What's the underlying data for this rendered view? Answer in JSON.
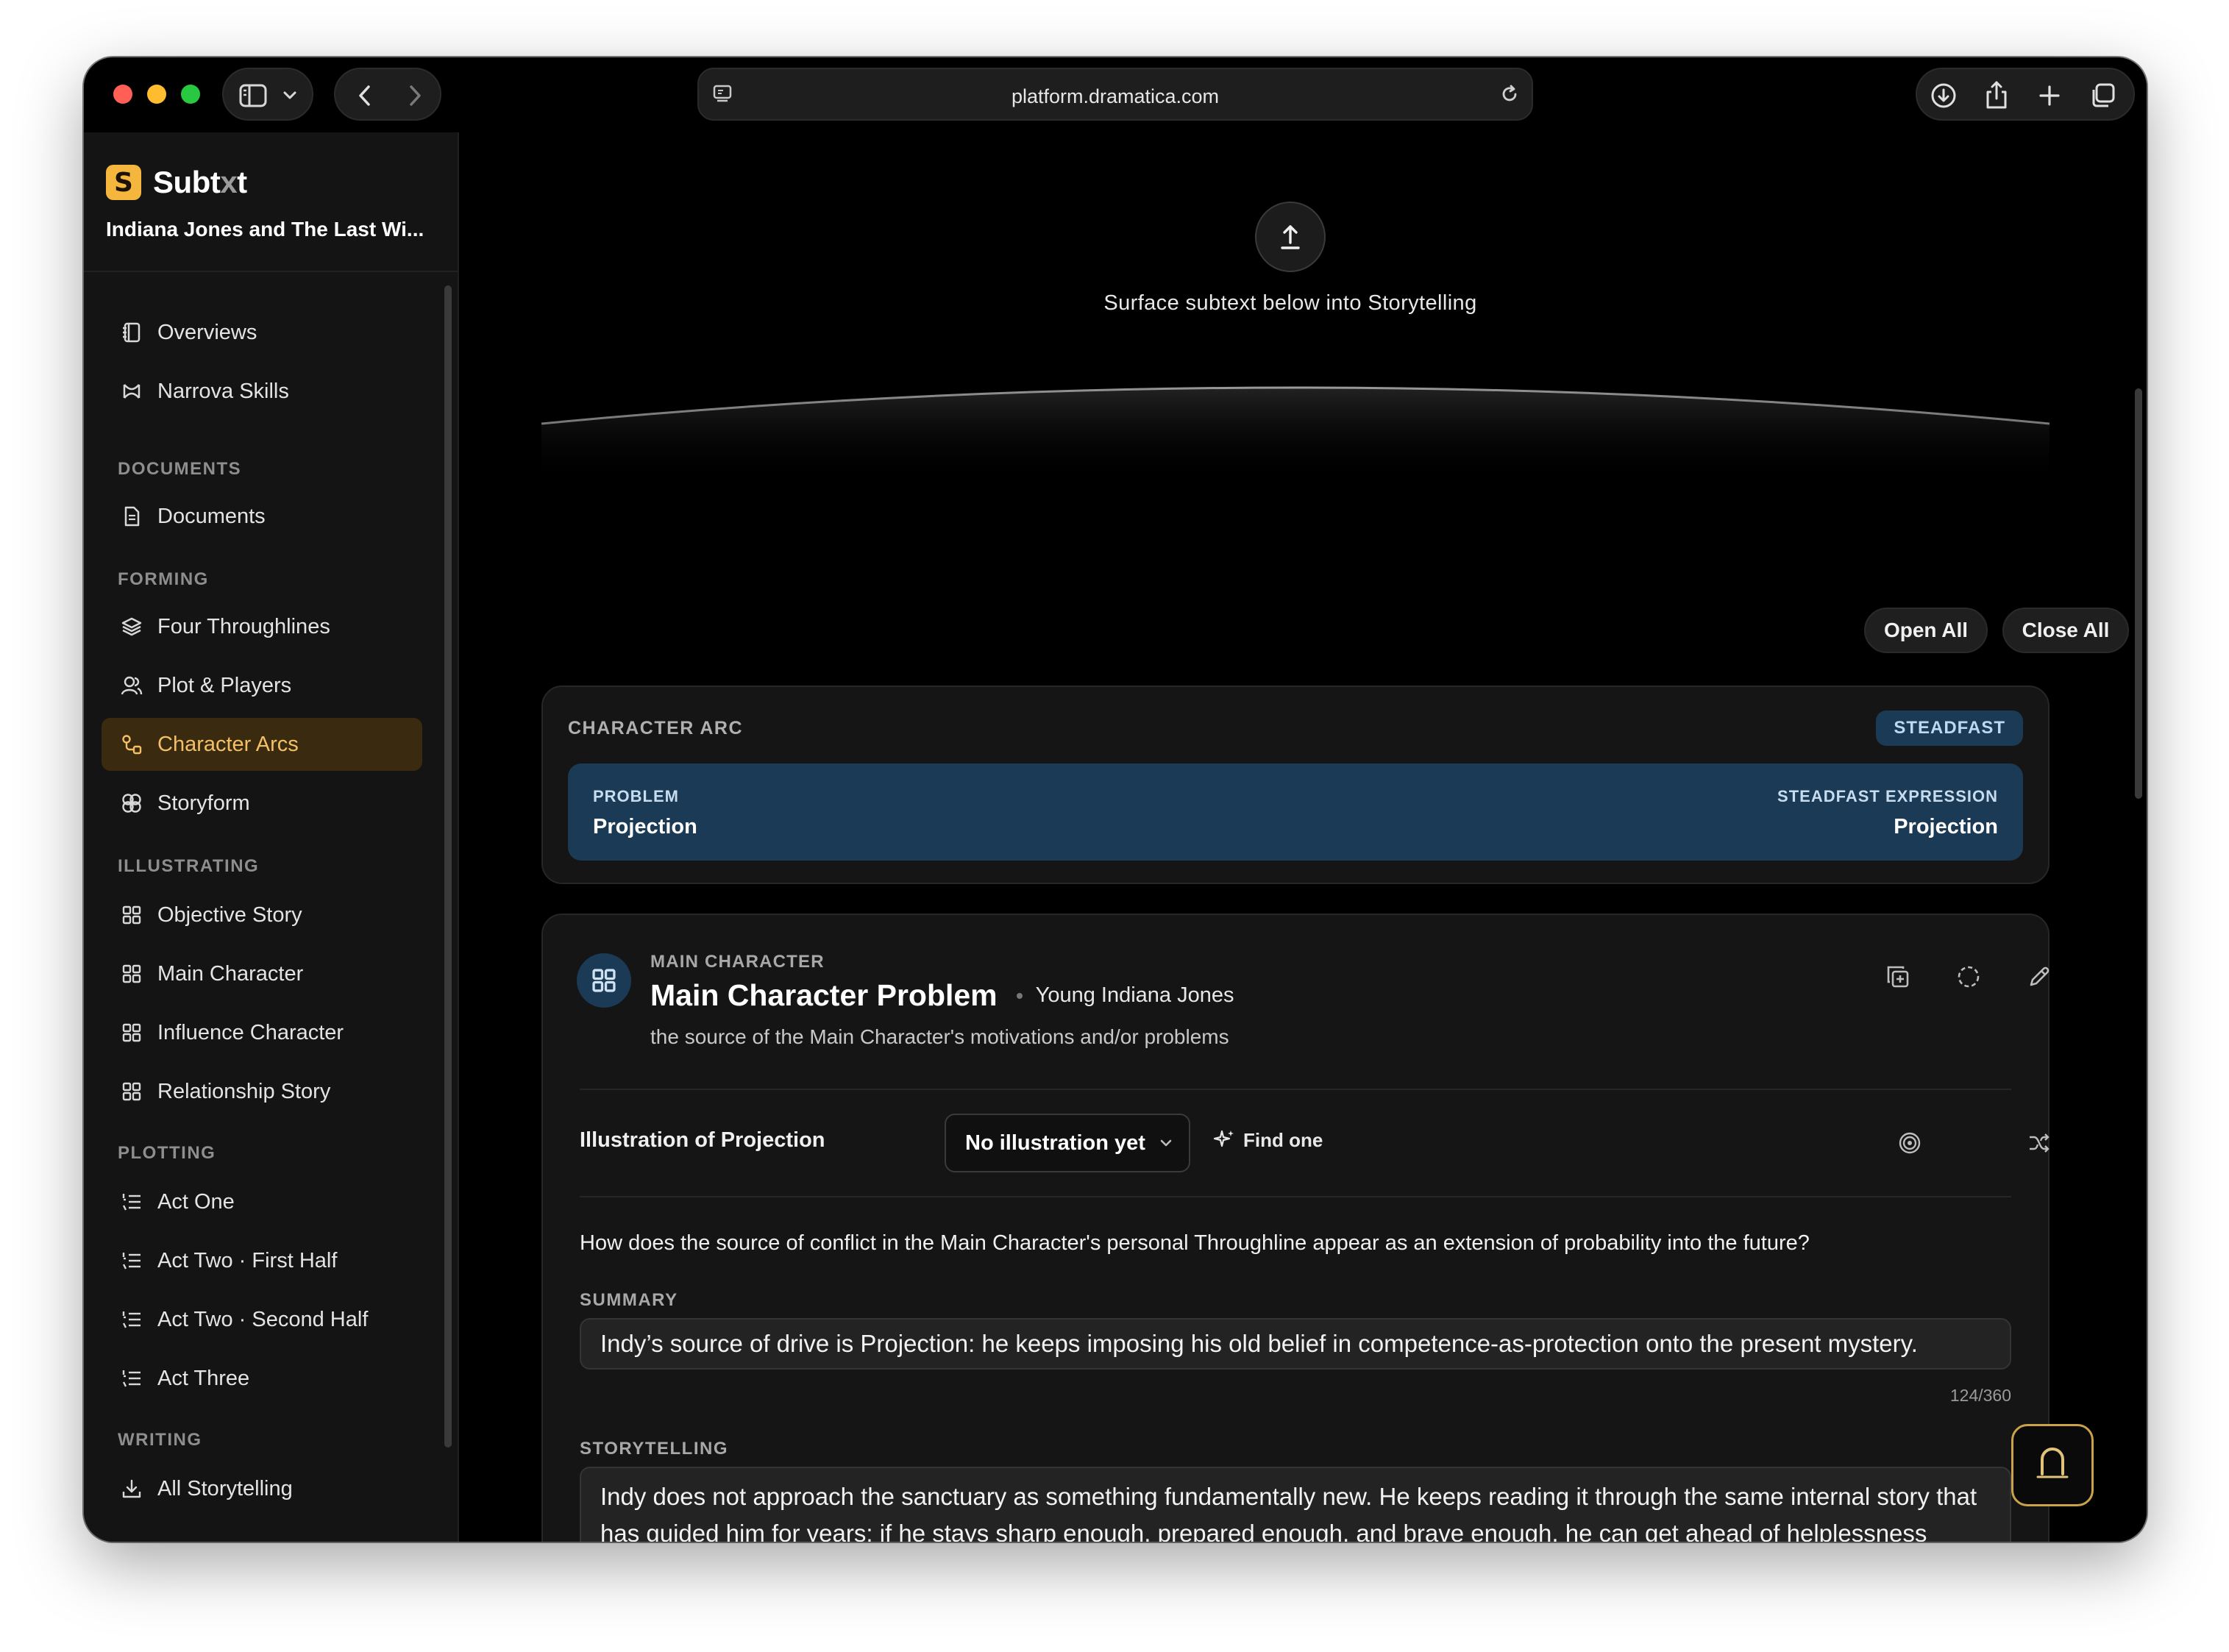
{
  "browser": {
    "url": "platform.dramatica.com"
  },
  "sidebar": {
    "app_name_main": "Subt",
    "app_name_accent": "x",
    "app_name_tail": "t",
    "logo_letter": "S",
    "project_title": "Indiana Jones and The Last Wi...",
    "items": [
      {
        "label": "Overviews",
        "icon": "book-icon"
      },
      {
        "label": "Narrova Skills",
        "icon": "skills-icon"
      }
    ],
    "sections": {
      "documents": "DOCUMENTS",
      "forming": "FORMING",
      "illustrating": "ILLUSTRATING",
      "plotting": "PLOTTING",
      "writing": "WRITING"
    },
    "documents_items": [
      {
        "label": "Documents",
        "icon": "document-icon"
      }
    ],
    "forming_items": [
      {
        "label": "Four Throughlines",
        "icon": "layers-icon"
      },
      {
        "label": "Plot & Players",
        "icon": "users-icon"
      },
      {
        "label": "Character Arcs",
        "icon": "arc-icon",
        "active": true
      },
      {
        "label": "Storyform",
        "icon": "storyform-icon"
      }
    ],
    "illustrating_items": [
      {
        "label": "Objective Story",
        "icon": "grid-icon"
      },
      {
        "label": "Main Character",
        "icon": "grid-icon"
      },
      {
        "label": "Influence Character",
        "icon": "grid-icon"
      },
      {
        "label": "Relationship Story",
        "icon": "grid-icon"
      }
    ],
    "plotting_items": [
      {
        "label": "Act One",
        "icon": "list-icon"
      },
      {
        "label": "Act Two · First Half",
        "icon": "list-icon"
      },
      {
        "label": "Act Two · Second Half",
        "icon": "list-icon"
      },
      {
        "label": "Act Three",
        "icon": "list-icon"
      }
    ],
    "writing_items": [
      {
        "label": "All Storytelling",
        "icon": "download-icon"
      }
    ]
  },
  "main": {
    "upload_caption": "Surface subtext below into Storytelling",
    "open_all": "Open All",
    "close_all": "Close All",
    "arc": {
      "label": "CHARACTER ARC",
      "badge": "STEADFAST",
      "problem_label": "PROBLEM",
      "problem_value": "Projection",
      "expression_label": "STEADFAST EXPRESSION",
      "expression_value": "Projection"
    },
    "mc": {
      "overline": "MAIN CHARACTER",
      "title": "Main Character Problem",
      "character": "Young Indiana Jones",
      "description": "the source of the Main Character's motivations and/or problems",
      "illustration_label": "Illustration of Projection",
      "illustration_value": "No illustration yet",
      "find_one": "Find one",
      "question": "How does the source of conflict in the Main Character's personal Throughline appear as an extension of probability into the future?",
      "summary_label": "SUMMARY",
      "summary": "Indy’s source of drive is Projection: he keeps imposing his old belief in competence-as-protection onto the present mystery.",
      "counter": "124/360",
      "storytelling_label": "STORYTELLING",
      "storytelling": "Indy does not approach the sanctuary as something fundamentally new. He keeps reading it through the same internal story that has guided him for years: if he stays sharp enough, prepared enough, and brave enough, he can get ahead of helplessness before it claims anyone. Every clue, warning, and impossible event gets filtered through that old need for mastery, so he repeatedly assumes the danger will yield to interpretation and control. What drives him deeper into trouble is"
    }
  },
  "colors": {
    "accent": "#f4b63c",
    "active_bg": "#3a2a10",
    "active_text": "#f4c066",
    "arc_panel": "#1b3a55"
  }
}
